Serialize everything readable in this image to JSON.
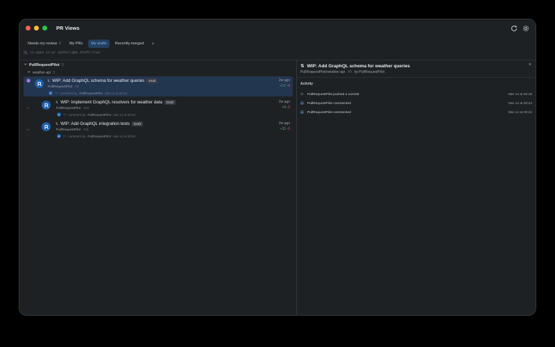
{
  "app": {
    "title": "PR Views"
  },
  "tabs": [
    {
      "label": "Needs my review",
      "count": "0",
      "active": false
    },
    {
      "label": "My PRs",
      "count": "",
      "active": false
    },
    {
      "label": "My drafts",
      "count": "",
      "active": true
    },
    {
      "label": "Recently merged",
      "count": "",
      "active": false
    }
  ],
  "tab_add": "+",
  "search": {
    "query": "is:open is:pr author:@me draft:true"
  },
  "group": {
    "name": "PullRequestPilot",
    "count": "3"
  },
  "repo": {
    "name": "weather-api",
    "count": "3"
  },
  "prs": [
    {
      "title": "WIP: Add GraphQL schema for weather queries",
      "draft_label": "Draft",
      "author": "PullRequestPilot",
      "number": "#9",
      "badge": "3",
      "comment_text": "comment by",
      "comment_author": "PullRequestPilot",
      "comment_time": "Mar 14 at 00:24",
      "ago": "2w ago",
      "additions": "+17",
      "deletions": "-0"
    },
    {
      "title": "WIP: Implement GraphQL resolvers for weather data",
      "draft_label": "Draft",
      "author": "PullRequestPilot",
      "number": "#10",
      "ghost": "1d",
      "comment_text": "comment by",
      "comment_author": "PullRequestPilot",
      "comment_time": "Mar 14 at 00:24",
      "ago": "2w ago",
      "additions": "+9",
      "deletions": "-0"
    },
    {
      "title": "WIP: Add GraphQL integration tests",
      "draft_label": "Draft",
      "author": "PullRequestPilot",
      "number": "#11",
      "ghost": "1d",
      "comment_text": "comment by",
      "comment_author": "PullRequestPilot",
      "comment_time": "Mar 14 at 00:24",
      "ago": "2w ago",
      "additions": "+11",
      "deletions": "-0"
    }
  ],
  "detail": {
    "title": "WIP: Add GraphQL schema for weather queries",
    "repo": "PullRequestPilot/weather-api",
    "number": "#9",
    "by": "by PullRequestPilot",
    "activity_label": "Activity",
    "activity": [
      {
        "kind": "commit",
        "text": "PullRequestPilot pushed a commit",
        "time": "Mar 14 at 00:18"
      },
      {
        "kind": "comment",
        "text": "PullRequestPilot commented",
        "time": "Mar 14 at 00:24"
      },
      {
        "kind": "comment",
        "text": "PullRequestPilot commented",
        "time": "Mar 14 at 00:24"
      }
    ]
  },
  "colors": {
    "accent": "#7fb2ef",
    "selected": "#233650",
    "add": "#4fb062",
    "del": "#e0605a"
  }
}
